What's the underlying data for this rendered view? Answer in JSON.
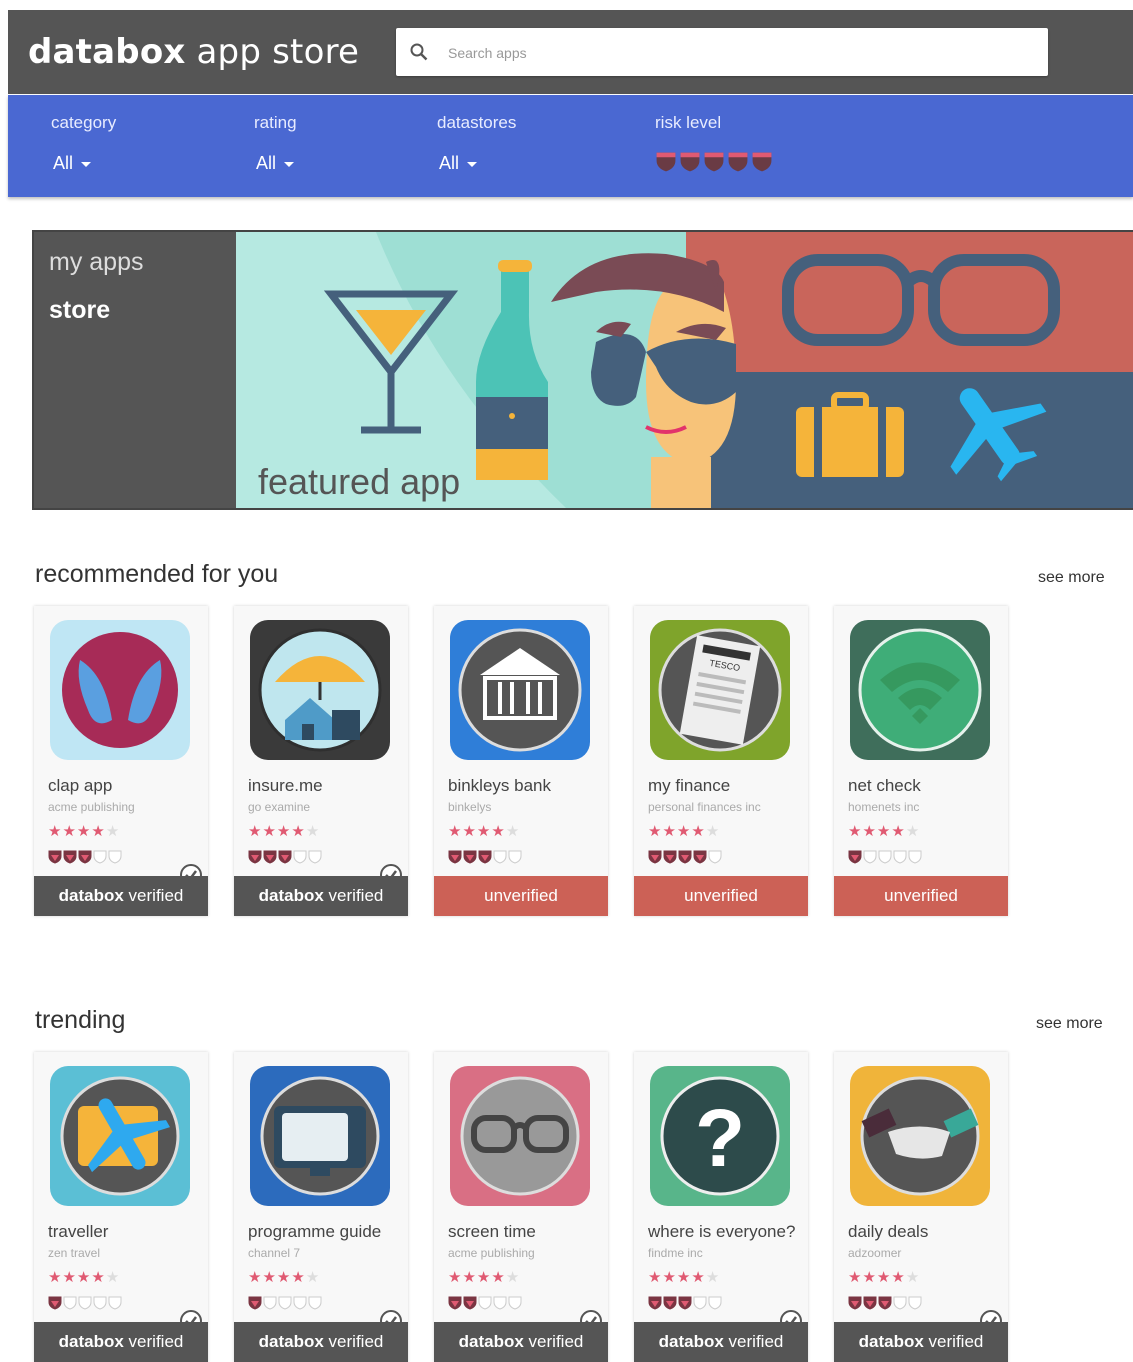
{
  "header": {
    "logo_bold": "databox",
    "logo_light": " app store",
    "search_placeholder": "Search apps"
  },
  "filters": [
    {
      "label": "category",
      "value": "All"
    },
    {
      "label": "rating",
      "value": "All"
    },
    {
      "label": "datastores",
      "value": "All"
    },
    {
      "label": "risk level",
      "risk_icons": 5
    }
  ],
  "nav": {
    "my_apps": "my apps",
    "store": "store"
  },
  "featured": {
    "label": "featured app"
  },
  "sections": [
    {
      "title": "recommended for you",
      "see_more": "see more",
      "apps": [
        {
          "name": "clap app",
          "publisher": "acme publishing",
          "stars": 4,
          "risk": 3,
          "status": "databox verified",
          "verified": true,
          "icon": "clap-hands-icon"
        },
        {
          "name": "insure.me",
          "publisher": "go examine",
          "stars": 4,
          "risk": 3,
          "status": "databox verified",
          "verified": true,
          "icon": "house-umbrella-icon"
        },
        {
          "name": "binkleys bank",
          "publisher": "binkelys",
          "stars": 4,
          "risk": 3,
          "status": "unverified",
          "verified": false,
          "icon": "bank-icon"
        },
        {
          "name": "my finance",
          "publisher": "personal finances inc",
          "stars": 4,
          "risk": 4,
          "status": "unverified",
          "verified": false,
          "icon": "receipt-icon"
        },
        {
          "name": "net check",
          "publisher": "homenets inc",
          "stars": 4,
          "risk": 1,
          "status": "unverified",
          "verified": false,
          "icon": "wifi-icon"
        }
      ]
    },
    {
      "title": "trending",
      "see_more": "see more",
      "apps": [
        {
          "name": "traveller",
          "publisher": "zen travel",
          "stars": 4,
          "risk": 1,
          "status": "databox verified",
          "verified": true,
          "icon": "suitcase-plane-icon"
        },
        {
          "name": "programme guide",
          "publisher": "channel 7",
          "stars": 4,
          "risk": 1,
          "status": "databox verified",
          "verified": true,
          "icon": "tv-icon"
        },
        {
          "name": "screen time",
          "publisher": "acme publishing",
          "stars": 4,
          "risk": 2,
          "status": "databox verified",
          "verified": true,
          "icon": "glasses-icon"
        },
        {
          "name": "where is everyone?",
          "publisher": "findme inc",
          "stars": 4,
          "risk": 3,
          "status": "databox verified",
          "verified": true,
          "icon": "question-mark-icon"
        },
        {
          "name": "daily deals",
          "publisher": "adzoomer",
          "stars": 4,
          "risk": 3,
          "status": "databox verified",
          "verified": true,
          "icon": "handshake-icon"
        }
      ]
    }
  ],
  "colors": {
    "header": "#555555",
    "filterbar": "#4a68d2",
    "unverified": "#cc6156",
    "star": "#e05a72"
  }
}
